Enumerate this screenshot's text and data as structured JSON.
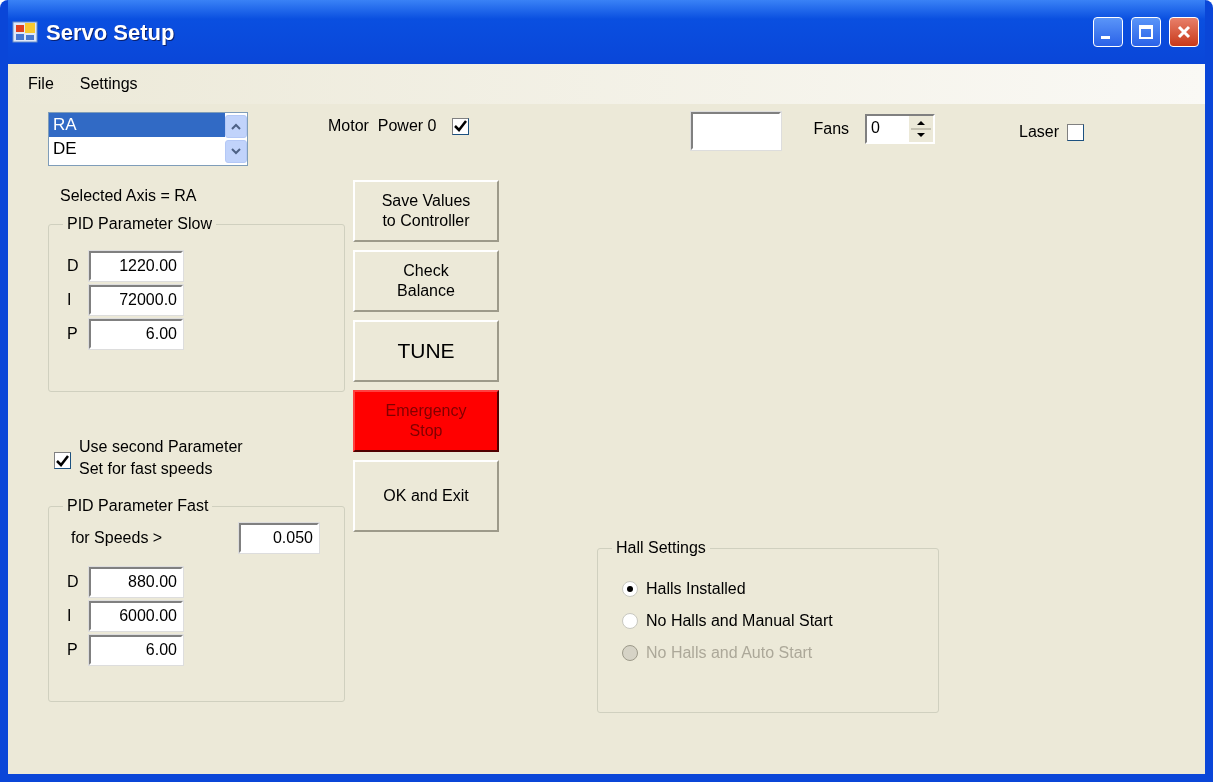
{
  "window": {
    "title": "Servo Setup"
  },
  "menu": [
    "File",
    "Settings"
  ],
  "axis_list": {
    "items": [
      {
        "label": "RA",
        "selected": true
      },
      {
        "label": "DE",
        "selected": false
      }
    ]
  },
  "motor_power": {
    "label": "Motor  Power 0",
    "checked": true
  },
  "fans": {
    "label": "Fans",
    "value": "0"
  },
  "laser": {
    "label": "Laser",
    "checked": false
  },
  "selected_axis": "Selected Axis = RA",
  "pid_slow": {
    "title": "PID Parameter Slow",
    "params": [
      {
        "label": "D",
        "value": "1220.00"
      },
      {
        "label": "I",
        "value": "72000.0"
      },
      {
        "label": "P",
        "value": "6.00"
      }
    ]
  },
  "second_set": {
    "label": "Use second Parameter\nSet for fast speeds",
    "checked": true
  },
  "pid_fast": {
    "title": "PID Parameter Fast",
    "speed_label": "for Speeds >",
    "speed_value": "0.050",
    "params": [
      {
        "label": "D",
        "value": "880.00"
      },
      {
        "label": "I",
        "value": "6000.00"
      },
      {
        "label": "P",
        "value": "6.00"
      }
    ]
  },
  "buttons": [
    {
      "label": "Save Values\nto Controller",
      "kind": "normal"
    },
    {
      "label": "Check\nBalance",
      "kind": "normal"
    },
    {
      "label": "TUNE",
      "kind": "large"
    },
    {
      "label": "Emergency\nStop",
      "kind": "danger"
    },
    {
      "label": "OK and Exit",
      "kind": "normal"
    }
  ],
  "hall_settings": {
    "title": "Hall Settings",
    "options": [
      {
        "label": "Halls Installed",
        "selected": true,
        "disabled": false
      },
      {
        "label": "No Halls and Manual Start",
        "selected": false,
        "disabled": false
      },
      {
        "label": "No Halls and Auto Start",
        "selected": false,
        "disabled": true
      }
    ]
  }
}
